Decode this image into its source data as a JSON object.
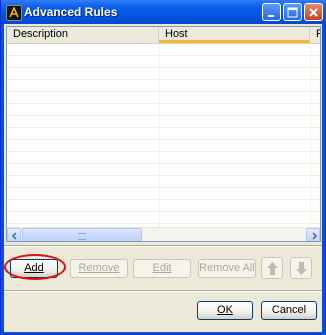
{
  "window": {
    "title": "Advanced Rules"
  },
  "list": {
    "columns": [
      "Description",
      "Host",
      "Po"
    ],
    "rows": []
  },
  "buttons": {
    "add": "Add",
    "remove": "Remove",
    "edit": "Edit",
    "remove_all": "Remove All",
    "ok": "OK",
    "cancel": "Cancel"
  },
  "colors": {
    "title_bar": "#0054e3",
    "highlight_ring": "#e01010",
    "column_sort_indicator": "#f8b330"
  },
  "icons": [
    "app-icon",
    "minimize-icon",
    "maximize-icon",
    "close-icon",
    "scroll-left-icon",
    "scroll-right-icon",
    "move-up-icon",
    "move-down-icon"
  ]
}
